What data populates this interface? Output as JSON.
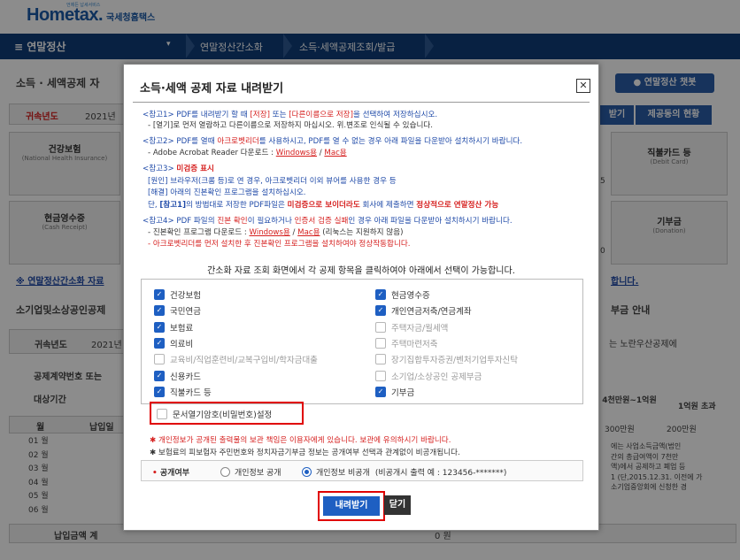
{
  "header": {
    "logo_brand": "Hometax.",
    "logo_sub": "국세청홈택스",
    "logo_tiny": "언제든 납세서비스"
  },
  "nav": {
    "menu_label": "≡  연말정산",
    "crumbs": [
      "연말정산간소화",
      "소득·세액공제조회/발급"
    ]
  },
  "background": {
    "page_title": "소득 · 세액공제 자",
    "chatbot": "연말정산 챗봇",
    "year_label": "귀속년도",
    "year_value": "2021년",
    "btn_download": "받기",
    "btn_consent": "제공동의 현황",
    "health": "건강보험",
    "health_en": "(National Health Insurance)",
    "debit": "직불카드 등",
    "debit_en": "(Debit Card)",
    "cash": "현금영수증",
    "cash_en": "(Cash Receipt)",
    "donation": "기부금",
    "donation_en": "(Donation)",
    "link_note": "※ 연말정산간소화 자료",
    "link_note2": "합니다.",
    "smallbiz": "소기업및소상공인공제",
    "donation_guide": "부금 안내",
    "year_label2": "귀속년도",
    "year_value2": "2021년",
    "noran": "는 노란우산공제에",
    "contract": "공제계약번호 또는 ",
    "period": "대상기간",
    "col_month": "월",
    "col_paid": "납입일",
    "tier1": "4천만원~1억원",
    "tier2": "1억원 초과",
    "amt1": "300만원",
    "amt2": "200만원",
    "months": [
      "01 월",
      "02 월",
      "03 월",
      "04 월",
      "05 월",
      "06 월"
    ],
    "side_text": [
      "에는 사업소득금액(법인",
      "간의 총급여액이 7천만",
      "액)에서 공제하고 폐업 등",
      "1 (단,2015.12.31. 이전에 가",
      "소기업중앙회에 신청한 경"
    ],
    "total_label": "납입금액 계",
    "total_value": "0 원",
    "counter1": "5",
    "counter2": "0"
  },
  "modal": {
    "title": "소득·세액 공제 자료 내려받기",
    "close_icon_label": "✕",
    "notes": {
      "n1_a": "<참고1> PDF를 내려받기 할 때 ",
      "n1_b": "[저장]",
      "n1_c": " 또는 ",
      "n1_d": "[다른이름으로 저장]",
      "n1_e": "을 선택하여 저장하십시오.",
      "n1_line2": "- [열기]로 먼저 열람하고 다른이름으로 저장하지 마십시오. 위.변조로 인식될 수 있습니다.",
      "n2_a": "<참고2> PDF를 열때 ",
      "n2_b": "아크로벳리더",
      "n2_c": "를 사용하시고, PDF를 열 수 없는 경우 아래 파일을 다운받아 설치하시기 바랍니다.",
      "n2_line2": "- Adobe Acrobat Reader 다운로드 : ",
      "n2_win": "Windows용",
      "n2_slash": " / ",
      "n2_mac": "Mac용",
      "n3_a": "<참고3> ",
      "n3_b": "미검증 표시",
      "n3_line2": "[원인] 브라우저(크롬 등)로 연 경우, 아크로벳리더 이외 뷰어를 사용한 경우 등",
      "n3_line3": "[해결] 아래의 진본확인 프로그램을 설치하십시오.",
      "n3_line4_a": "단, ",
      "n3_line4_b": "[참고1]",
      "n3_line4_c": "의 방법대로 저장한 PDF파일은 ",
      "n3_line4_d": "미검증으로 보이더라도",
      "n3_line4_e": " 회사에 제출하면 ",
      "n3_line4_f": "정상적으로 연말정산 가능",
      "n4_a": "<참고4> PDF 파일의 ",
      "n4_b": "진본 확인",
      "n4_c": "이 필요하거나 ",
      "n4_d": "인증서 검증 실패",
      "n4_e": "인 경우 아래 파일을 다운받아 설치하시기 바랍니다.",
      "n4_line2": "- 진본확인 프로그램 다운로드 : ",
      "n4_win": "Windows용",
      "n4_slash": " / ",
      "n4_mac": "Mac용",
      "n4_line2_tail": " (리눅스는 지원하지 않음)",
      "n4_line3": "- 아크로벳리더를 먼저 설치한 후 진본확인 프로그램을 설치하여야 정상작동합니다."
    },
    "guide": "간소화 자료 조회 화면에서 각 공제 항목을 클릭하여야 아래에서 선택이 가능합니다.",
    "checkboxes_left": [
      {
        "label": "건강보험",
        "checked": true,
        "disabled": false
      },
      {
        "label": "국민연금",
        "checked": true,
        "disabled": false
      },
      {
        "label": "보험료",
        "checked": true,
        "disabled": false
      },
      {
        "label": "의료비",
        "checked": true,
        "disabled": false
      },
      {
        "label": "교육비/직업훈련비/교복구입비/학자금대출",
        "checked": false,
        "disabled": true
      },
      {
        "label": "신용카드",
        "checked": true,
        "disabled": false
      },
      {
        "label": "직불카드 등",
        "checked": true,
        "disabled": false
      }
    ],
    "checkboxes_right": [
      {
        "label": "현금영수증",
        "checked": true,
        "disabled": false
      },
      {
        "label": "개인연금저축/연금계좌",
        "checked": true,
        "disabled": false
      },
      {
        "label": "주택자금/월세액",
        "checked": false,
        "disabled": true
      },
      {
        "label": "주택마련저축",
        "checked": false,
        "disabled": true
      },
      {
        "label": "장기집합투자증권/벤처기업투자신탁",
        "checked": false,
        "disabled": true
      },
      {
        "label": "소기업/소상공인 공제부금",
        "checked": false,
        "disabled": true
      },
      {
        "label": "기부금",
        "checked": true,
        "disabled": false
      }
    ],
    "password_option": "문서열기암호(비밀번호)설정",
    "warn1": "개인정보가 공개된 출력물의 보관 책임은 이용자에게 있습니다. 보관에 유의하시기 바랍니다.",
    "warn2": "보험료의 피보험자 주민번호와 정치자금기부금 정보는 공개여부 선택과 관계없이 비공개됩니다.",
    "public_label": "공개여부",
    "radio_public": "개인정보 공개",
    "radio_private": "개인정보 비공개",
    "radio_private_hint": "(비공개시 출력 예 : 123456-*******)",
    "download_button": "내려받기",
    "close_button": "닫기"
  },
  "colors": {
    "navy": "#0f3c78",
    "blue": "#1e5fc2",
    "red": "#d6201f"
  }
}
